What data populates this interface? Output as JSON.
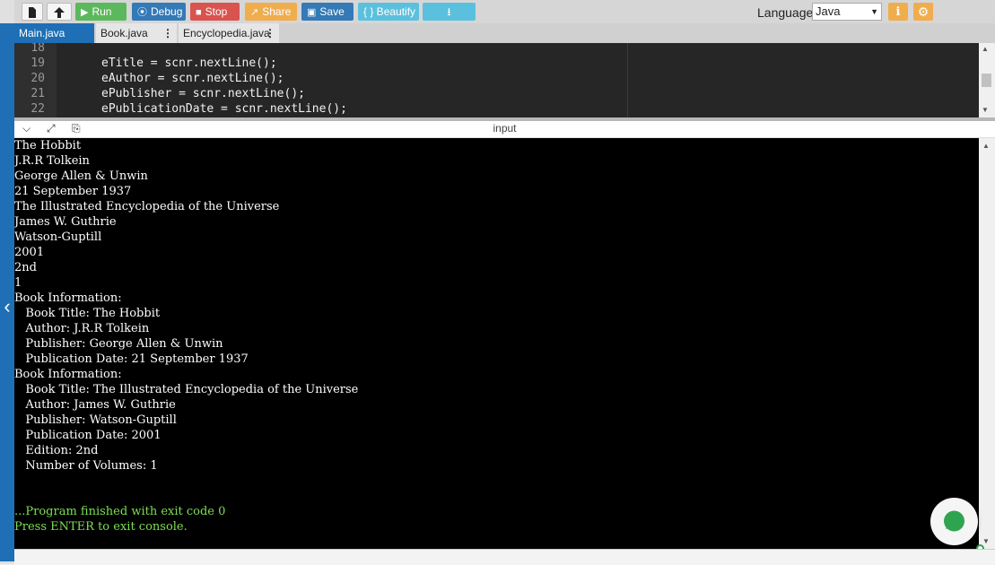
{
  "toolbar": {
    "run": "Run",
    "debug": "Debug",
    "stop": "Stop",
    "share": "Share",
    "save": "Save",
    "beautify": "{ } Beautify",
    "language_label": "Language",
    "language_value": "Java"
  },
  "tabs": [
    {
      "label": "Main.java",
      "active": true
    },
    {
      "label": "Book.java",
      "active": false
    },
    {
      "label": "Encyclopedia.java",
      "active": false
    }
  ],
  "editor": {
    "line_numbers": [
      "18",
      "19",
      "20",
      "21",
      "22"
    ],
    "lines": [
      "",
      "eTitle = scnr.nextLine();",
      "eAuthor = scnr.nextLine();",
      "ePublisher = scnr.nextLine();",
      "ePublicationDate = scnr.nextLine();"
    ]
  },
  "io": {
    "label": "input"
  },
  "console": {
    "lines": [
      "The Hobbit",
      "J.R.R Tolkein",
      "George Allen & Unwin",
      "21 September 1937",
      "The Illustrated Encyclopedia of the Universe",
      "James W. Guthrie",
      "Watson-Guptill",
      "2001",
      "2nd",
      "1",
      "Book Information:",
      "   Book Title: The Hobbit",
      "   Author: J.R.R Tolkein",
      "   Publisher: George Allen & Unwin",
      "   Publication Date: 21 September 1937",
      "Book Information:",
      "   Book Title: The Illustrated Encyclopedia of the Universe",
      "   Author: James W. Guthrie",
      "   Publisher: Watson-Guptill",
      "   Publication Date: 2001",
      "   Edition: 2nd",
      "   Number of Volumes: 1",
      "",
      "",
      "...Program finished with exit code 0",
      "Press ENTER to exit console."
    ]
  },
  "colors": {
    "run": "#5cb85c",
    "debug": "#337ab7",
    "stop": "#d9534f",
    "share": "#f0ad4e",
    "accent": "#1e6fb5",
    "console_green": "#7dde52"
  },
  "icons": [
    "new-file-icon",
    "upload-icon",
    "play-icon",
    "debug-icon",
    "stop-icon",
    "share-icon",
    "save-icon",
    "download-icon",
    "info-icon",
    "gear-icon",
    "chevron-down-icon",
    "expand-icon",
    "paste-icon",
    "chat-icon",
    "chevron-left-icon"
  ]
}
